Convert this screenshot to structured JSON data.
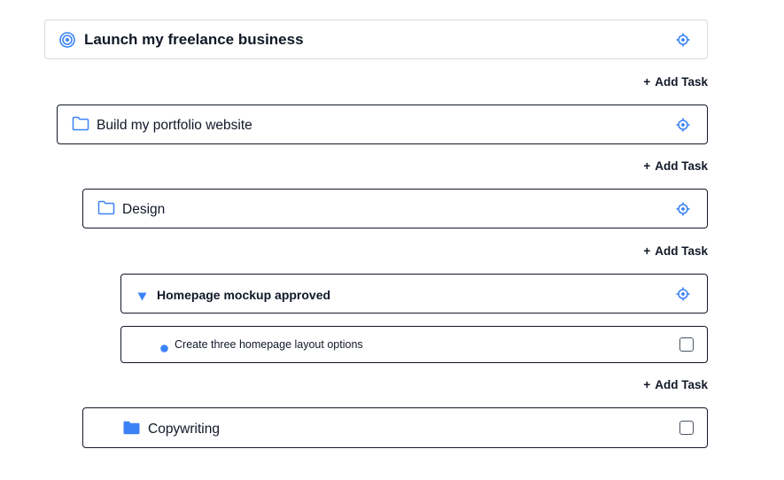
{
  "accent_color": "#3b82f6",
  "goal": {
    "title": "Launch my freelance business",
    "icon": "target-icon",
    "action_icon": "crosshair-icon"
  },
  "add_task": {
    "plus": "+",
    "label": "Add Task"
  },
  "project": {
    "title": "Build my portfolio website",
    "icon": "folder-outline-icon",
    "action_icon": "crosshair-icon"
  },
  "subproject": {
    "title": "Design",
    "icon": "folder-outline-icon",
    "action_icon": "crosshair-icon"
  },
  "milestone": {
    "title": "Homepage mockup approved",
    "icon": "triangle-down-icon",
    "action_icon": "crosshair-icon"
  },
  "task": {
    "title": "Create three homepage layout options",
    "icon": "bullet-dot-icon",
    "checked": false
  },
  "subproject2": {
    "title": "Copywriting",
    "icon": "folder-filled-icon",
    "checked": false
  }
}
